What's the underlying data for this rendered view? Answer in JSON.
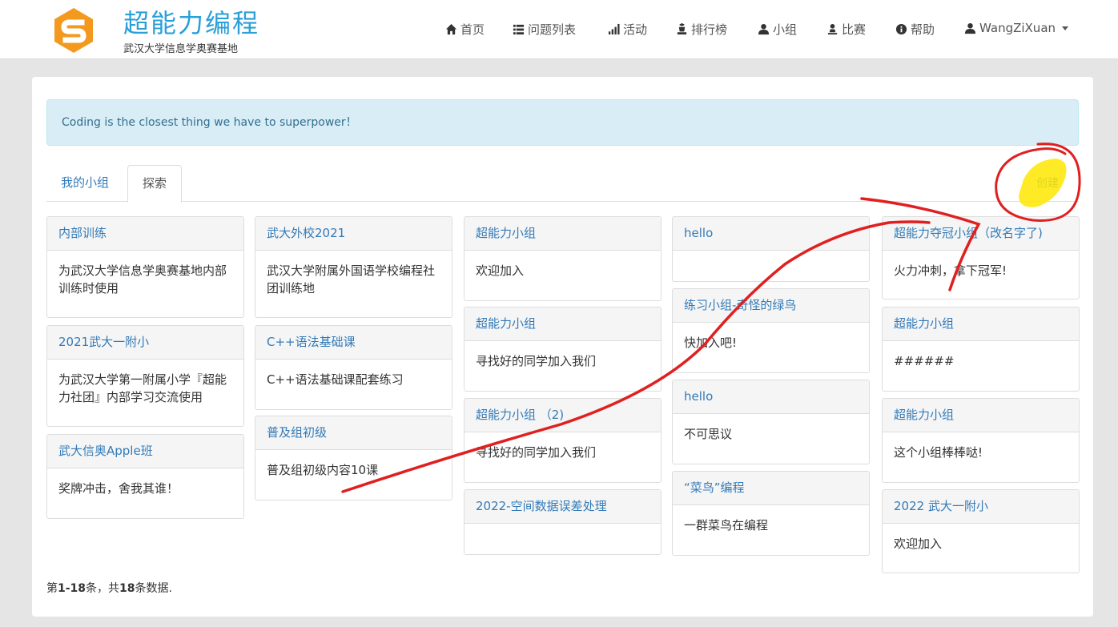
{
  "brand": {
    "title": "超能力编程",
    "subtitle": "武汉大学信息学奥赛基地"
  },
  "nav": [
    {
      "label": "首页",
      "icon": "home-icon"
    },
    {
      "label": "问题列表",
      "icon": "list-icon"
    },
    {
      "label": "活动",
      "icon": "signal-icon"
    },
    {
      "label": "排行榜",
      "icon": "chess-icon"
    },
    {
      "label": "小组",
      "icon": "user-icon"
    },
    {
      "label": "比赛",
      "icon": "pawn-icon"
    },
    {
      "label": "帮助",
      "icon": "info-circle-icon"
    },
    {
      "label": "WangZiXuan",
      "icon": "user-icon"
    }
  ],
  "alert": "Coding is the closest thing we have to superpower！",
  "tabs": [
    "我的小组",
    "探索"
  ],
  "create_label": "创建",
  "groups": [
    {
      "title": "内部训练",
      "desc": "为武汉大学信息学奥赛基地内部训练时使用"
    },
    {
      "title": "2021武大一附小",
      "desc": "为武汉大学第一附属小学『超能力社团』内部学习交流使用"
    },
    {
      "title": "武大信奥Apple班",
      "desc": "奖牌冲击，舍我其谁！"
    },
    {
      "title": "武大外校2021",
      "desc": "武汉大学附属外国语学校编程社团训练地"
    },
    {
      "title": "C++语法基础课",
      "desc": "C++语法基础课配套练习"
    },
    {
      "title": "普及组初级",
      "desc": "普及组初级内容10课"
    },
    {
      "title": "超能力小组",
      "desc": "欢迎加入"
    },
    {
      "title": "超能力小组",
      "desc": "寻找好的同学加入我们"
    },
    {
      "title": "超能力小组 （2)",
      "desc": "寻找好的同学加入我们"
    },
    {
      "title": "2022-空间数据误差处理",
      "desc": ""
    },
    {
      "title": "hello",
      "desc": ""
    },
    {
      "title": "练习小组-奇怪的绿鸟",
      "desc": "快加入吧!"
    },
    {
      "title": "hello",
      "desc": "不可思议"
    },
    {
      "title": "“菜鸟”编程",
      "desc": "一群菜鸟在编程"
    },
    {
      "title": "超能力夺冠小组（改名字了)",
      "desc": "火力冲刺，拿下冠军!"
    },
    {
      "title": "超能力小组",
      "desc": "######"
    },
    {
      "title": "超能力小组",
      "desc": "这个小组棒棒哒!"
    },
    {
      "title": "2022 武大一附小",
      "desc": "欢迎加入"
    }
  ],
  "pager": {
    "prefix": "第",
    "range": "1-18",
    "mid": "条，共",
    "total": "18",
    "suffix": "条数据."
  },
  "colors": {
    "link": "#337ab7",
    "brand": "#2a9fd8",
    "logo": "#f39a1e",
    "annotation_red": "#e02020",
    "annotation_yellow": "#ffe600"
  }
}
